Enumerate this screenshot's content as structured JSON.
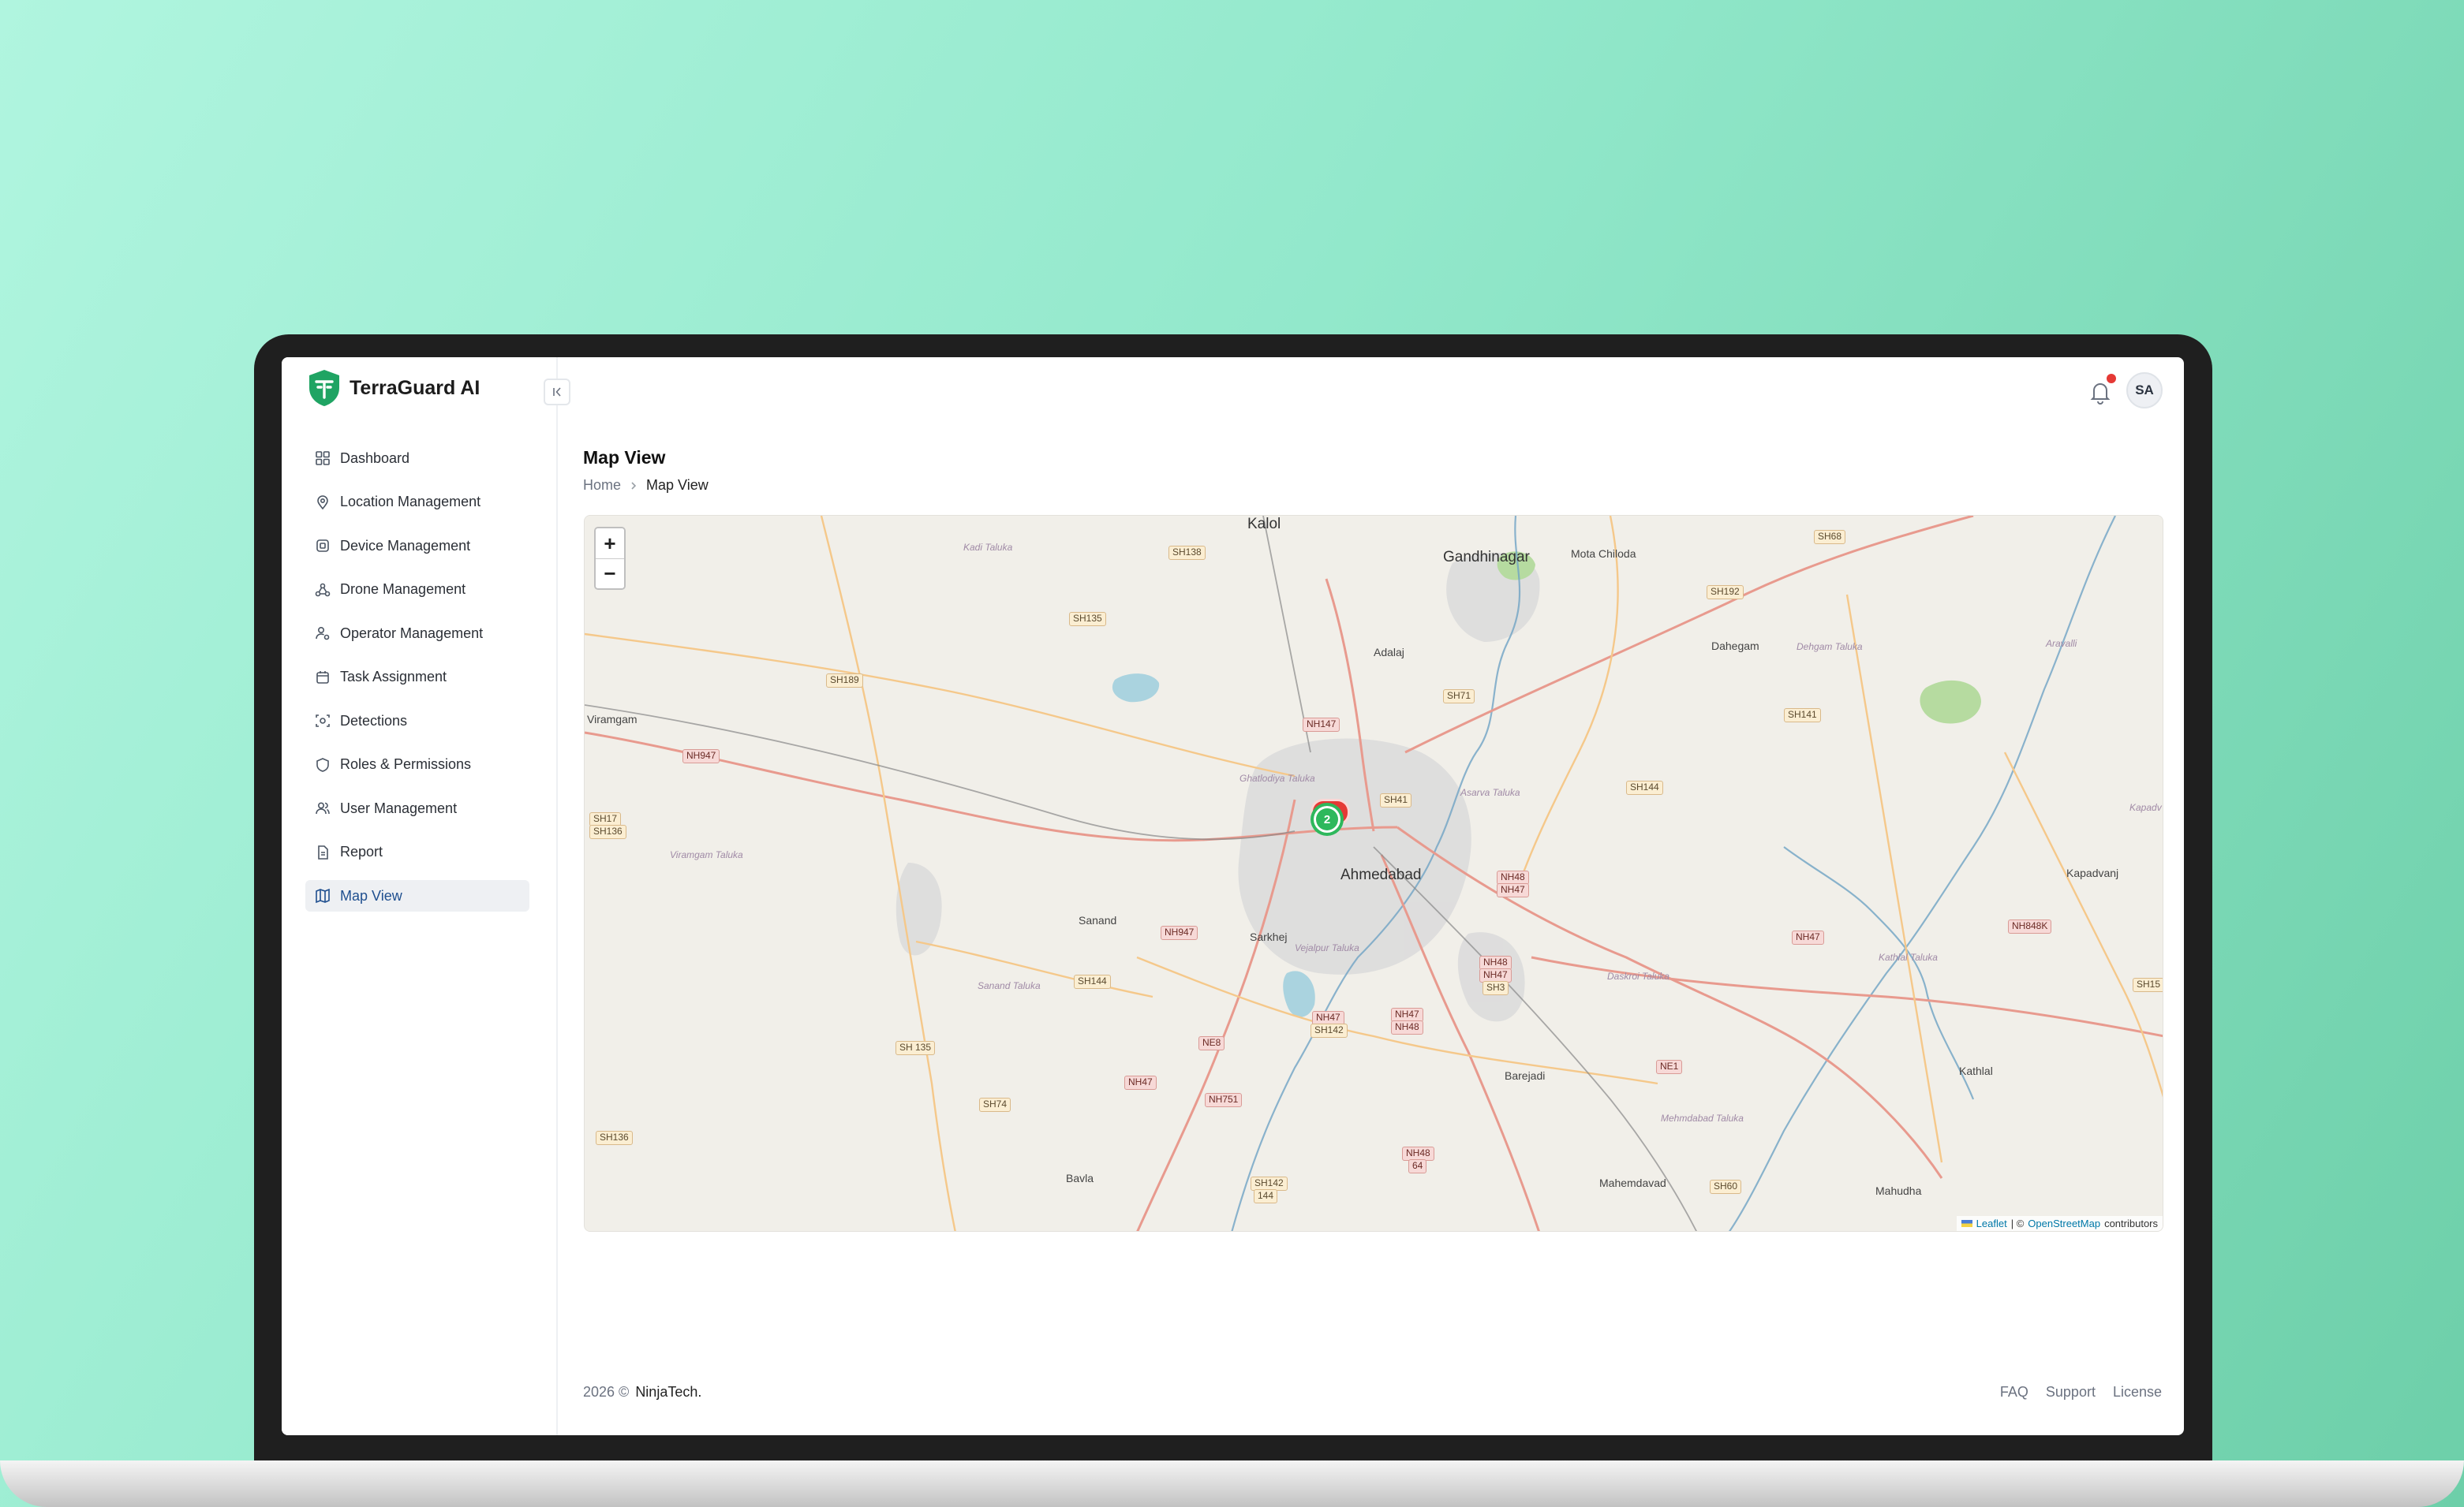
{
  "app": {
    "name": "TerraGuard AI"
  },
  "header": {
    "avatar_initials": "SA"
  },
  "sidebar": {
    "items": [
      {
        "label": "Dashboard",
        "icon": "grid-icon"
      },
      {
        "label": "Location Management",
        "icon": "location-pin-icon"
      },
      {
        "label": "Device Management",
        "icon": "chip-icon"
      },
      {
        "label": "Drone Management",
        "icon": "drone-icon"
      },
      {
        "label": "Operator Management",
        "icon": "user-gear-icon"
      },
      {
        "label": "Task Assignment",
        "icon": "calendar-icon"
      },
      {
        "label": "Detections",
        "icon": "scan-icon"
      },
      {
        "label": "Roles & Permissions",
        "icon": "shield-icon"
      },
      {
        "label": "User Management",
        "icon": "users-icon"
      },
      {
        "label": "Report",
        "icon": "document-icon"
      },
      {
        "label": "Map View",
        "icon": "map-icon",
        "active": true
      }
    ]
  },
  "page": {
    "title": "Map View",
    "breadcrumb": [
      "Home",
      "Map View"
    ]
  },
  "map": {
    "zoom_in": "+",
    "zoom_out": "−",
    "cluster_count": "2",
    "attribution": {
      "leaflet": "Leaflet",
      "sep": "| ©",
      "osm": "OpenStreetMap",
      "suffix": "contributors"
    },
    "places": {
      "kalol": "Kalol",
      "gandhinagar": "Gandhinagar",
      "mota_chiloda": "Mota Chiloda",
      "adalaj": "Adalaj",
      "dahegam": "Dahegam",
      "viramgam": "Viramgam",
      "ahmedabad": "Ahmedabad",
      "sanand": "Sanand",
      "sarkhej": "Sarkhej",
      "kapadvanj": "Kapadvanj",
      "barejadi": "Barejadi",
      "kathlal": "Kathlal",
      "bavla": "Bavla",
      "mahemdavad": "Mahemdavad",
      "mahudha": "Mahudha"
    },
    "talukas": {
      "kadi": "Kadi Taluka",
      "dehgam": "Dehgam Taluka",
      "viramgam": "Viramgam Taluka",
      "ghatlodiya": "Ghatlodiya Taluka",
      "asarva": "Asarva Taluka",
      "vejalpur": "Vejalpur Taluka",
      "sanand": "Sanand Taluka",
      "daskroi": "Daskroi Taluka",
      "kathlal": "Kathlal Taluka",
      "mehmdabad": "Mehmdabad Taluka",
      "aravalli": "Aravalli",
      "kapadvanj": "Kapadv Taluka"
    },
    "roads": {
      "sh138": "SH138",
      "sh68": "SH68",
      "sh135": "SH135",
      "sh192": "SH192",
      "sh189": "SH189",
      "sh71": "SH71",
      "nh147": "NH147",
      "sh141": "SH141",
      "nh947a": "NH947",
      "sh41": "SH41",
      "sh144a": "SH144",
      "sh17": "SH17",
      "sh136a": "SH136",
      "nh48a": "NH48",
      "nh47a": "NH47",
      "nh947b": "NH947",
      "sh144b": "SH144",
      "nh47b": "NH47",
      "nh848k": "NH848K",
      "nh48b": "NH48",
      "nh47c": "NH47",
      "sh3": "SH3",
      "sh15": "SH15",
      "nh47d": "NH47",
      "sh142a": "SH142",
      "nh47e": "NH47",
      "nh48c": "NH48",
      "ne8": "NE8",
      "sh135b": "SH 135",
      "ne1": "NE1",
      "nh47f": "NH47",
      "nh751": "NH751",
      "sh74": "SH74",
      "sh136b": "SH136",
      "nh48d": "NH48",
      "n64": "64",
      "sh142b": "SH142",
      "n144": "144",
      "sh60": "SH60"
    }
  },
  "footer": {
    "year": "2026 ©",
    "company": "NinjaTech.",
    "links": [
      "FAQ",
      "Support",
      "License"
    ]
  },
  "colors": {
    "accent_green": "#2eb85c",
    "alert_red": "#e53935",
    "active_nav_text": "#1f4f8f"
  }
}
